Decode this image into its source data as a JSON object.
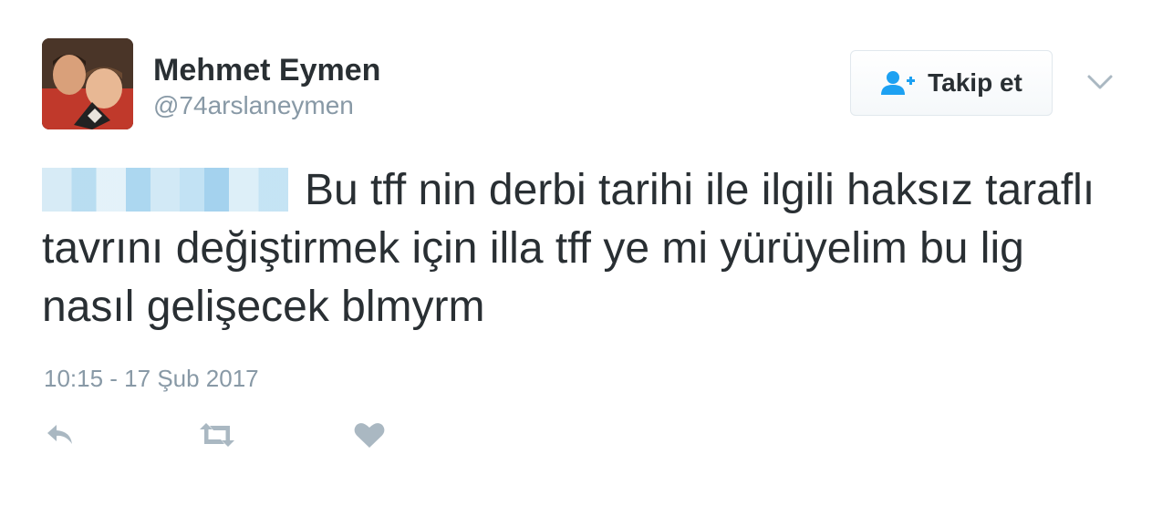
{
  "user": {
    "display_name": "Mehmet Eymen",
    "handle": "@74arslaneymen"
  },
  "follow_button": {
    "label": "Takip et",
    "icon": "add-user-icon"
  },
  "tweet": {
    "text": "Bu tff nin derbi tarihi ile ilgili haksız taraflı tavrını değiştirmek için illa tff ye mi yürüyelim bu lig nasıl gelişecek blmyrm",
    "timestamp": "10:15 - 17 Şub 2017"
  },
  "actions": [
    "reply-icon",
    "retweet-icon",
    "heart-icon"
  ],
  "colors": {
    "text": "#292f33",
    "muted": "#8899a6",
    "accent": "#1da1f2",
    "icon": "#aab8c2"
  }
}
